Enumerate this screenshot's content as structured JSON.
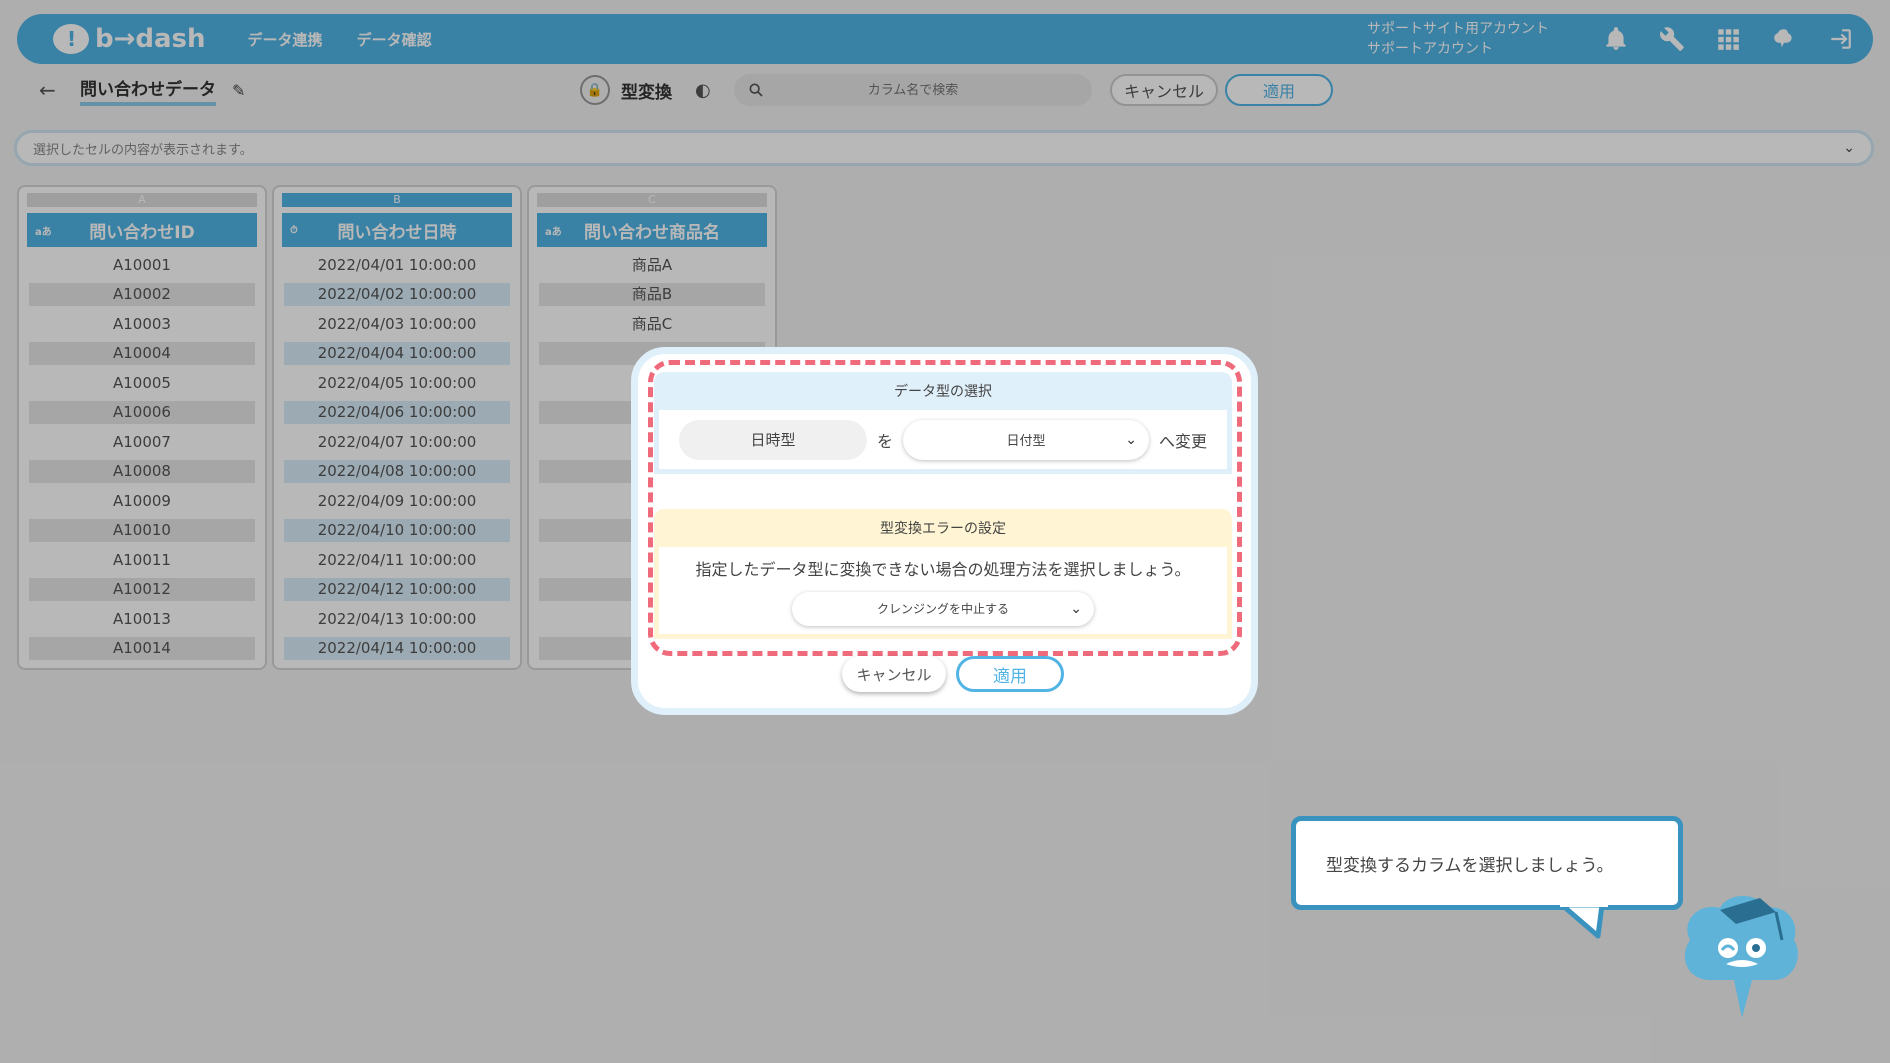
{
  "header": {
    "logo_text": "b→dash",
    "nav": [
      "データ連携",
      "データ確認"
    ],
    "account_line1": "サポートサイト用アカウント",
    "account_line2": "サポートアカウント"
  },
  "subbar": {
    "back_icon": "←",
    "data_title": "問い合わせデータ",
    "edit_icon": "✎",
    "lock_icon": "🔒",
    "tool_name": "型変換",
    "shield_icon": "◐",
    "search_placeholder": "カラム名で検索",
    "cancel_label": "キャンセル",
    "apply_label": "適用"
  },
  "cellbar": {
    "placeholder": "選択したセルの内容が表示されます。",
    "chevron": "⌄"
  },
  "columns": [
    {
      "letter": "A",
      "type_tag": "aあ",
      "name": "問い合わせID",
      "cells": [
        "A10001",
        "A10002",
        "A10003",
        "A10004",
        "A10005",
        "A10006",
        "A10007",
        "A10008",
        "A10009",
        "A10010",
        "A10011",
        "A10012",
        "A10013",
        "A10014"
      ]
    },
    {
      "letter": "B",
      "type_tag": "⏱",
      "name": "問い合わせ日時",
      "cells": [
        "2022/04/01 10:00:00",
        "2022/04/02 10:00:00",
        "2022/04/03 10:00:00",
        "2022/04/04 10:00:00",
        "2022/04/05 10:00:00",
        "2022/04/06 10:00:00",
        "2022/04/07 10:00:00",
        "2022/04/08 10:00:00",
        "2022/04/09 10:00:00",
        "2022/04/10 10:00:00",
        "2022/04/11 10:00:00",
        "2022/04/12 10:00:00",
        "2022/04/13 10:00:00",
        "2022/04/14 10:00:00"
      ]
    },
    {
      "letter": "C",
      "type_tag": "aあ",
      "name": "問い合わせ商品名",
      "cells": [
        "商品A",
        "商品B",
        "商品C",
        "",
        "",
        "",
        "",
        "",
        "",
        "",
        "",
        "",
        "",
        ""
      ]
    }
  ],
  "modal": {
    "section1_title": "データ型の選択",
    "from_type": "日時型",
    "wo": "を",
    "to_type": "日付型",
    "to_suffix": "へ変更",
    "section2_title": "型変換エラーの設定",
    "error_desc": "指定したデータ型に変換できない場合の処理方法を選択しましょう。",
    "error_option": "クレンジングを中止する",
    "chevron": "⌄",
    "cancel_label": "キャンセル",
    "apply_label": "適用"
  },
  "tutorial": {
    "message": "型変換するカラムを選択しましょう。"
  },
  "colors": {
    "brand": "#51b4e5",
    "highlight_dash": "#ef6b7b",
    "section_blue": "#e0f0fa",
    "section_yellow": "#fff4d3",
    "tip_border": "#3a93bf"
  },
  "icons": {
    "header": [
      "bell-icon",
      "wrench-icon",
      "grid-icon",
      "brain-icon",
      "logout-icon"
    ]
  }
}
